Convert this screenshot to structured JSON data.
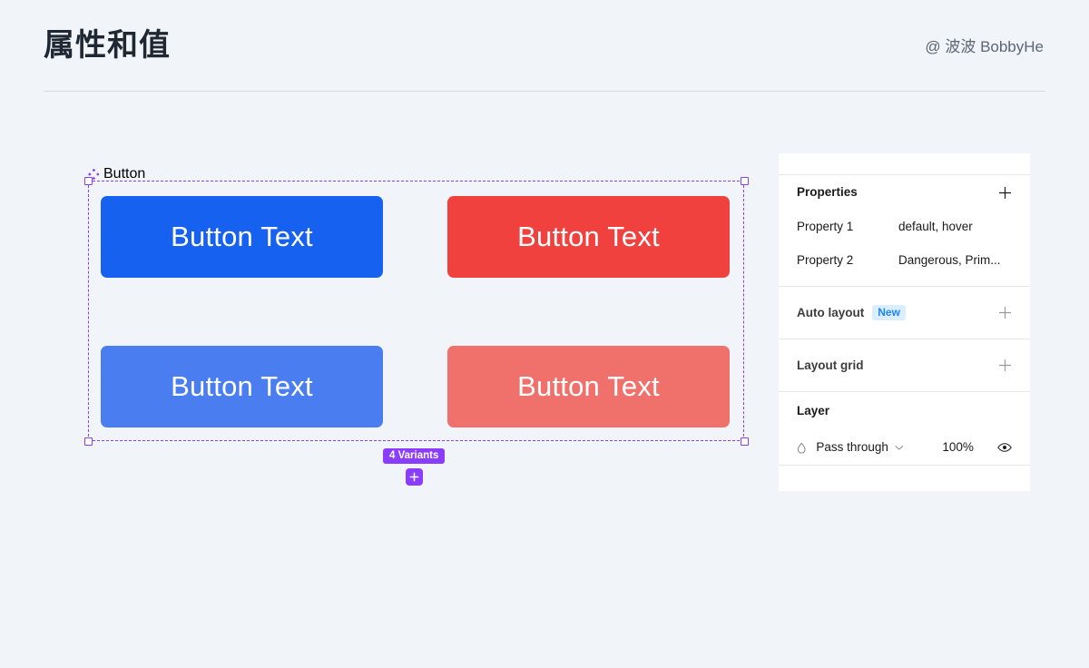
{
  "header": {
    "title": "属性和值",
    "byline": "@ 波波 BobbyHe"
  },
  "canvas": {
    "component_set": {
      "icon": "component-set-icon",
      "label": "Button",
      "selection_color": "#8b3dff",
      "variants_badge": "4 Variants",
      "add_variant_icon": "plus-icon",
      "buttons": [
        {
          "label": "Button Text",
          "color": "#1661f0",
          "state": "Primary / default"
        },
        {
          "label": "Button Text",
          "color": "#f1413e",
          "state": "Dangerous / default"
        },
        {
          "label": "Button Text",
          "color": "#4a7df0",
          "state": "Primary / hover"
        },
        {
          "label": "Button Text",
          "color": "#f0706c",
          "state": "Dangerous / hover"
        }
      ]
    }
  },
  "inspector": {
    "properties": {
      "title": "Properties",
      "add_icon": "plus-icon",
      "rows": [
        {
          "name": "Property 1",
          "value": "default, hover"
        },
        {
          "name": "Property 2",
          "value": "Dangerous, Prim..."
        }
      ]
    },
    "auto_layout": {
      "title": "Auto layout",
      "badge": "New",
      "badge_color": "#1d85f7",
      "add_icon": "plus-icon"
    },
    "layout_grid": {
      "title": "Layout grid",
      "add_icon": "plus-icon"
    },
    "layer": {
      "title": "Layer",
      "blend_icon": "blend-mode-icon",
      "blend_mode": "Pass through",
      "chevron_icon": "chevron-down-icon",
      "opacity": "100%",
      "visibility_icon": "eye-icon"
    }
  }
}
